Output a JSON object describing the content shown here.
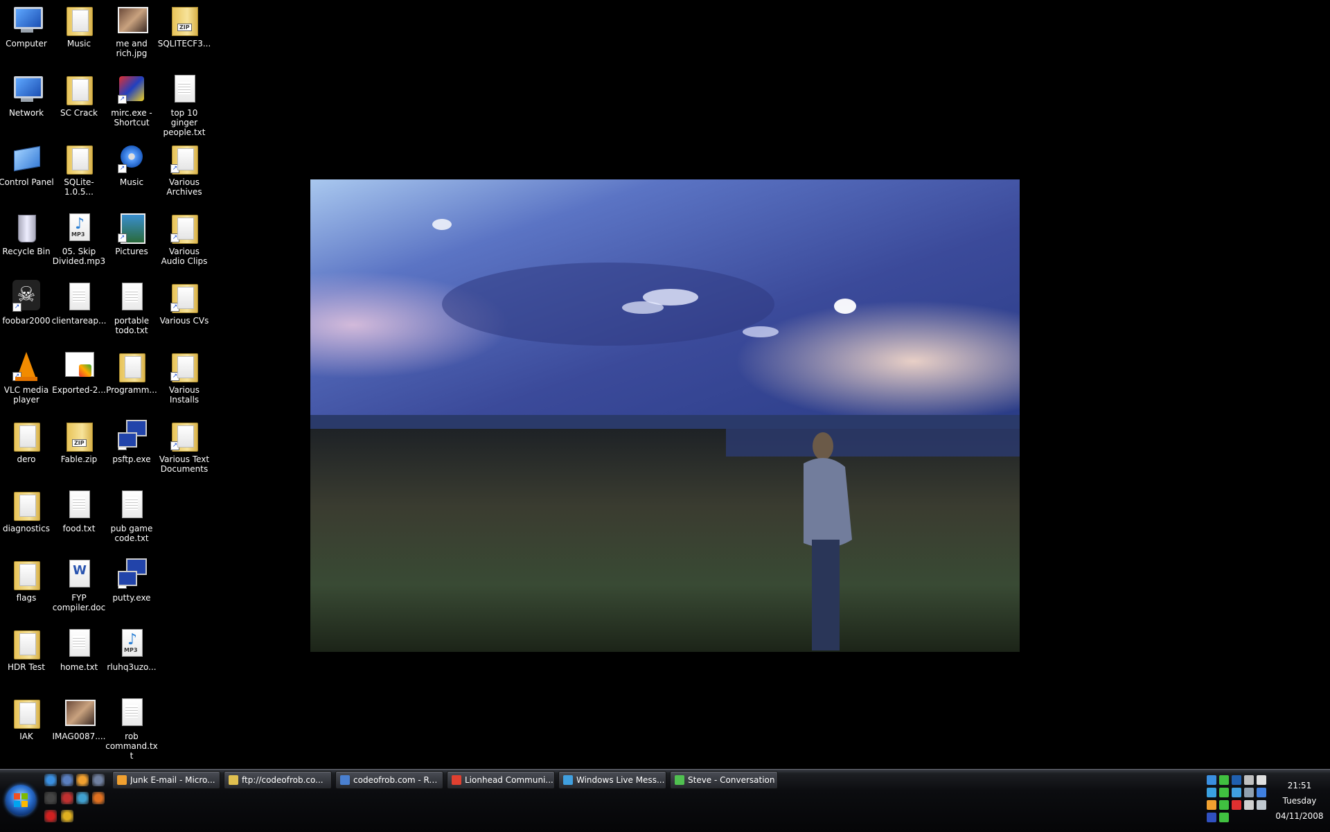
{
  "desktop": {
    "icons": [
      {
        "label": "Computer",
        "icon": "computer-icon"
      },
      {
        "label": "Music",
        "icon": "folder-icon"
      },
      {
        "label": "me and rich.jpg",
        "icon": "photo-icon"
      },
      {
        "label": "SQLITECF3...",
        "icon": "zip-folder-icon"
      },
      {
        "label": "Network",
        "icon": "network-icon"
      },
      {
        "label": "SC Crack",
        "icon": "folder-icon"
      },
      {
        "label": "mirc.exe - Shortcut",
        "icon": "mirc-icon"
      },
      {
        "label": "top 10 ginger people.txt",
        "icon": "text-file-icon"
      },
      {
        "label": "Control Panel",
        "icon": "control-panel-icon"
      },
      {
        "label": "SQLite-1.0.5...",
        "icon": "folder-icon"
      },
      {
        "label": "Music",
        "icon": "media-player-icon"
      },
      {
        "label": "Various Archives",
        "icon": "folder-shortcut-icon"
      },
      {
        "label": "Recycle Bin",
        "icon": "recycle-bin-icon"
      },
      {
        "label": "05. Skip Divided.mp3",
        "icon": "mp3-file-icon"
      },
      {
        "label": "Pictures",
        "icon": "pictures-icon"
      },
      {
        "label": "Various Audio Clips",
        "icon": "folder-shortcut-icon"
      },
      {
        "label": "foobar2000",
        "icon": "foobar-icon"
      },
      {
        "label": "clientareap...",
        "icon": "text-file-icon"
      },
      {
        "label": "portable todo.txt",
        "icon": "text-file-icon"
      },
      {
        "label": "Various CVs",
        "icon": "folder-shortcut-icon"
      },
      {
        "label": "VLC media player",
        "icon": "vlc-icon"
      },
      {
        "label": "Exported-2...",
        "icon": "exported-file-icon"
      },
      {
        "label": "Programm...",
        "icon": "folder-icon"
      },
      {
        "label": "Various Installs",
        "icon": "folder-shortcut-icon"
      },
      {
        "label": "dero",
        "icon": "folder-icon"
      },
      {
        "label": "Fable.zip",
        "icon": "zip-folder-icon"
      },
      {
        "label": "psftp.exe",
        "icon": "psftp-icon"
      },
      {
        "label": "Various Text Documents",
        "icon": "folder-shortcut-icon"
      },
      {
        "label": "diagnostics",
        "icon": "folder-icon"
      },
      {
        "label": "food.txt",
        "icon": "text-file-icon"
      },
      {
        "label": "pub game code.txt",
        "icon": "text-file-icon"
      },
      {
        "label": "flags",
        "icon": "folder-icon"
      },
      {
        "label": "FYP compiler.doc",
        "icon": "word-doc-icon"
      },
      {
        "label": "putty.exe",
        "icon": "putty-icon"
      },
      {
        "label": "HDR Test",
        "icon": "folder-icon"
      },
      {
        "label": "home.txt",
        "icon": "text-file-icon"
      },
      {
        "label": "rluhq3uzo...",
        "icon": "mp3-file-icon"
      },
      {
        "label": "IAK",
        "icon": "folder-icon"
      },
      {
        "label": "IMAG0087....",
        "icon": "photo-icon"
      },
      {
        "label": "rob command.txt",
        "icon": "text-file-icon"
      }
    ]
  },
  "taskbar": {
    "quick_launch": [
      "internet-explorer-icon",
      "show-desktop-icon",
      "messenger-icon",
      "switch-windows-icon",
      "foobar-icon",
      "app-icon",
      "contacts-icon",
      "firefox-icon",
      "opera-icon",
      "chrome-icon"
    ],
    "buttons": [
      {
        "label": "Junk E-mail - Micro...",
        "icon": "outlook-icon",
        "color": "#f0a030"
      },
      {
        "label": "ftp://codeofrob.co...",
        "icon": "ftp-folder-icon",
        "color": "#e0c050"
      },
      {
        "label": "codeofrob.com - Re...",
        "icon": "remote-desktop-icon",
        "color": "#4a80d0"
      },
      {
        "label": "Lionhead Communi...",
        "icon": "chrome-icon",
        "color": "#e04030"
      },
      {
        "label": "Windows Live Mess...",
        "icon": "messenger-icon",
        "color": "#40a0e0"
      },
      {
        "label": "Steve - Conversation",
        "icon": "messenger-conversation-icon",
        "color": "#50c050"
      }
    ],
    "clock": {
      "time": "21:51",
      "day": "Tuesday",
      "date": "04/11/2008"
    }
  }
}
